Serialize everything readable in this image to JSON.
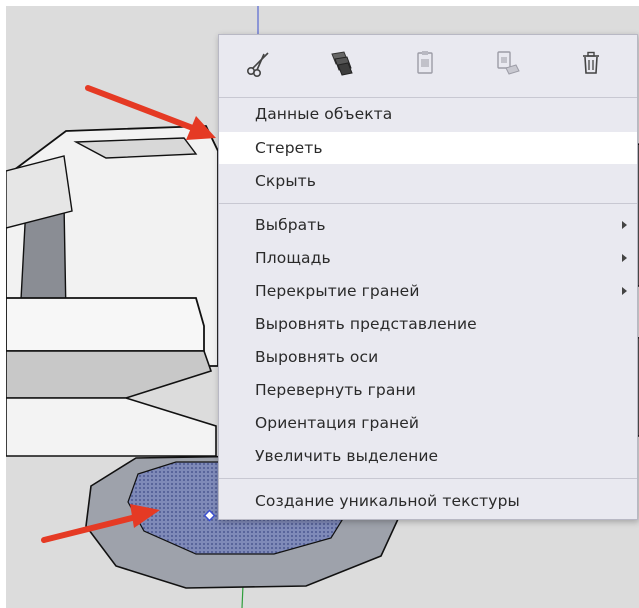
{
  "toolbar": {
    "icons": [
      "cut-icon",
      "copy-icon",
      "paste-icon",
      "paste-in-place-icon",
      "delete-icon"
    ],
    "enabled": [
      true,
      true,
      false,
      false,
      true
    ]
  },
  "menu": {
    "items": [
      {
        "label": "Данные объекта"
      },
      {
        "label": "Стереть"
      },
      {
        "label": "Скрыть"
      },
      {
        "label": "Выбрать"
      },
      {
        "label": "Площадь"
      },
      {
        "label": "Перекрытие граней"
      },
      {
        "label": "Выровнять представление"
      },
      {
        "label": "Выровнять оси"
      },
      {
        "label": "Перевернуть грани"
      },
      {
        "label": "Ориентация граней"
      },
      {
        "label": "Увеличить выделение"
      },
      {
        "label": "Создание уникальной текстуры"
      }
    ]
  },
  "colors": {
    "menu_bg": "#e9e9f0",
    "highlight": "#ffffff",
    "arrow": "#e53a24",
    "selection_fill": "#5b6aa8",
    "axis_green": "#2f9e3b",
    "axis_blue": "#3b4fd1",
    "axis_red": "#d12a2a"
  }
}
